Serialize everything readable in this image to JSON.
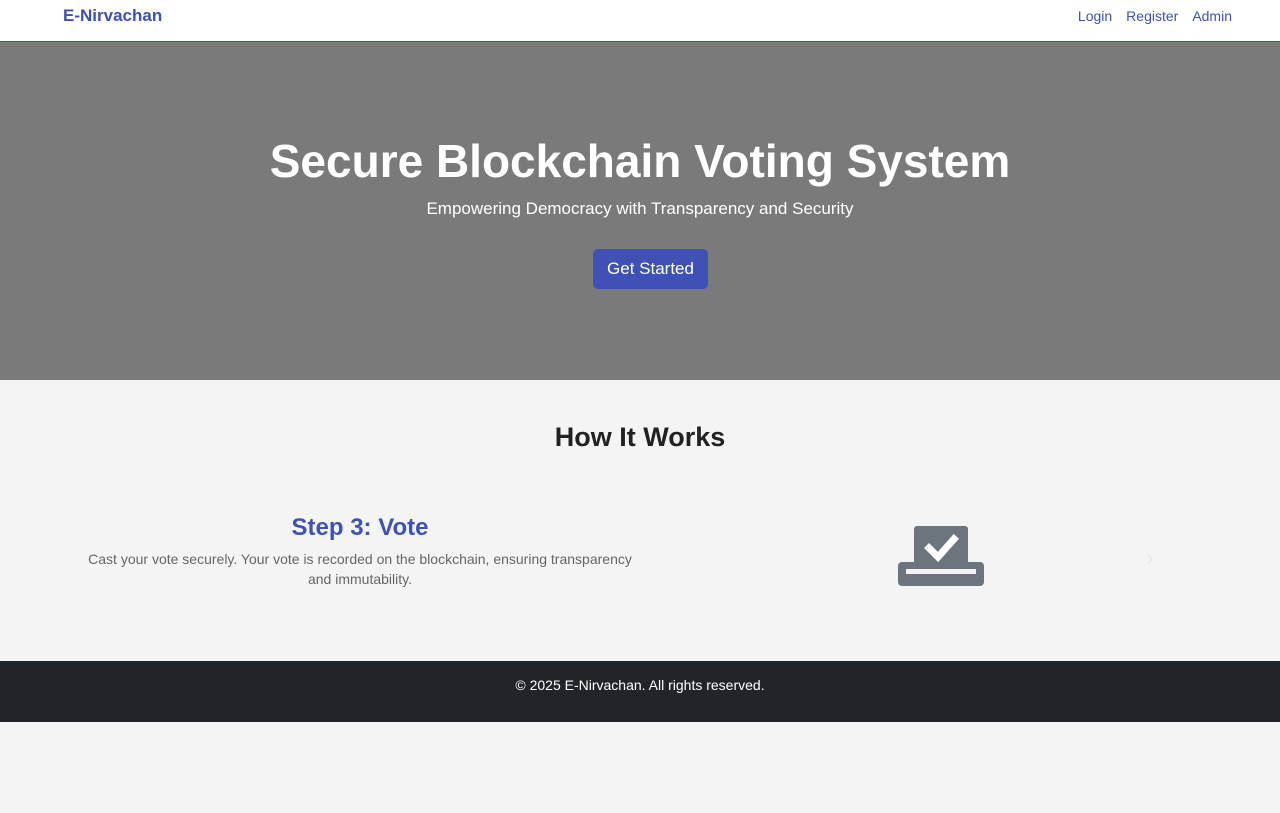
{
  "navbar": {
    "brand": "E-Nirvachan",
    "links": [
      "Login",
      "Register",
      "Admin"
    ]
  },
  "hero": {
    "title": "Secure Blockchain Voting System",
    "subtitle": "Empowering Democracy with Transparency and Security",
    "cta_label": "Get Started"
  },
  "how_it_works": {
    "heading": "How It Works",
    "step": {
      "title": "Step 3: Vote",
      "description": "Cast your vote securely. Your vote is recorded on the blockchain, ensuring transparency and immutability.",
      "icon": "vote-ballot-icon"
    },
    "next_control": "›"
  },
  "footer": {
    "text": "© 2025 E-Nirvachan. All rights reserved."
  },
  "colors": {
    "brand": "#3f51b5",
    "hero_bg": "#7a7a7a",
    "footer_bg": "#212529",
    "icon": "#6c757d"
  }
}
